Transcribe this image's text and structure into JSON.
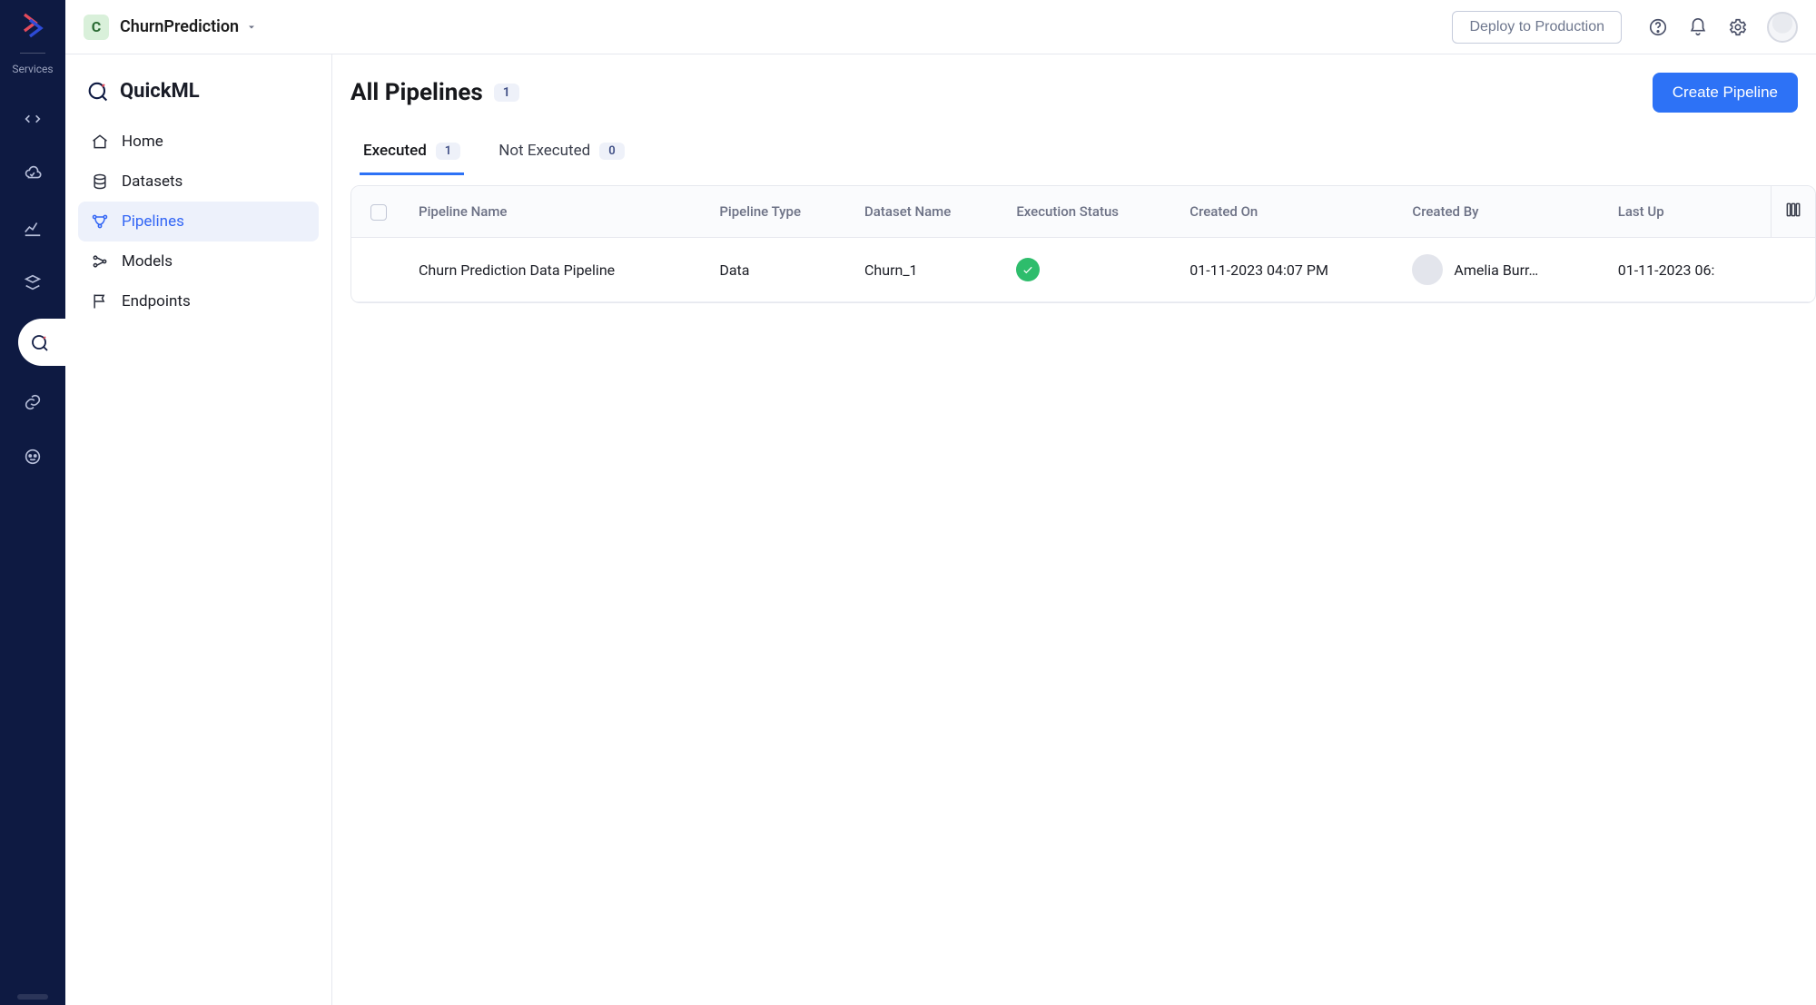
{
  "rail": {
    "servicesLabel": "Services"
  },
  "topbar": {
    "projectInitial": "C",
    "projectName": "ChurnPrediction",
    "deployLabel": "Deploy to Production"
  },
  "sidebar": {
    "brand": "QuickML",
    "items": [
      {
        "label": "Home"
      },
      {
        "label": "Datasets"
      },
      {
        "label": "Pipelines"
      },
      {
        "label": "Models"
      },
      {
        "label": "Endpoints"
      }
    ]
  },
  "page": {
    "title": "All Pipelines",
    "count": "1",
    "createLabel": "Create Pipeline"
  },
  "tabs": {
    "executed": {
      "label": "Executed",
      "count": "1"
    },
    "notExecuted": {
      "label": "Not Executed",
      "count": "0"
    }
  },
  "table": {
    "headers": {
      "pipelineName": "Pipeline Name",
      "pipelineType": "Pipeline Type",
      "datasetName": "Dataset Name",
      "executionStatus": "Execution Status",
      "createdOn": "Created On",
      "createdBy": "Created By",
      "lastUpdated": "Last Up"
    },
    "rows": [
      {
        "pipelineName": "Churn Prediction Data Pipeline",
        "pipelineType": "Data",
        "datasetName": "Churn_1",
        "createdOn": "01-11-2023 04:07 PM",
        "createdBy": "Amelia Burr…",
        "lastUpdated": "01-11-2023 06:"
      }
    ]
  }
}
